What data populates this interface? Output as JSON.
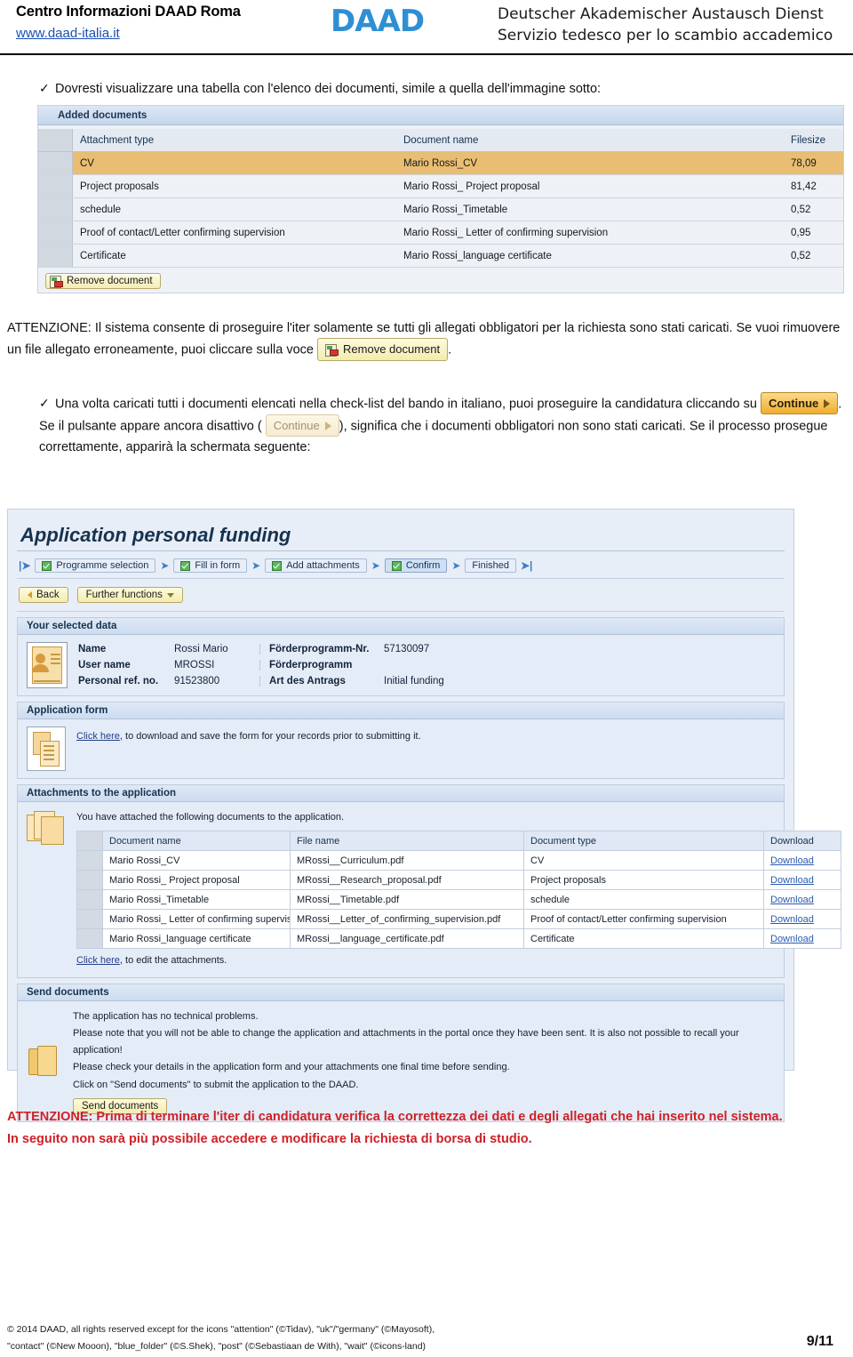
{
  "header": {
    "org_title": "Centro Informazioni DAAD Roma",
    "url": "www.daad-italia.it",
    "logo": "DAAD",
    "line1": "Deutscher Akademischer Austausch Dienst",
    "line2": "Servizio tedesco per lo scambio accademico"
  },
  "intro": {
    "bullet1": "Dovresti visualizzare una tabella con l'elenco dei documenti, simile a quella dell'immagine sotto:"
  },
  "added_documents": {
    "panel_title": "Added documents",
    "columns": [
      "Attachment type",
      "Document name",
      "Filesize"
    ],
    "rows": [
      {
        "type": "CV",
        "name": "Mario Rossi_CV",
        "size": "78,09",
        "selected": true
      },
      {
        "type": "Project proposals",
        "name": "Mario Rossi_ Project proposal",
        "size": "81,42",
        "selected": false
      },
      {
        "type": "schedule",
        "name": "Mario Rossi_Timetable",
        "size": "0,52",
        "selected": false
      },
      {
        "type": "Proof of contact/Letter confirming supervision",
        "name": "Mario Rossi_ Letter of confirming supervision",
        "size": "0,95",
        "selected": false
      },
      {
        "type": "Certificate",
        "name": "Mario Rossi_language certificate",
        "size": "0,52",
        "selected": false
      }
    ],
    "remove_button": "Remove document"
  },
  "warning_para": {
    "part1": "ATTENZIONE: Il sistema consente di proseguire l'iter solamente se tutti gli allegati obbligatori per la richiesta sono stati caricati.  Se vuoi rimuovere un file allegato erroneamente, puoi cliccare sulla voce",
    "remove_button": "Remove document",
    "part2": "."
  },
  "bullet2": {
    "part1": "Una volta caricati tutti i documenti elencati nella check-list del bando in italiano, puoi proseguire la candidatura cliccando su",
    "continue_active": "Continue",
    "part2": ". Se il pulsante appare ancora disattivo (",
    "continue_disabled": "Continue",
    "part3": "), significa che i documenti obbligatori non sono stati caricati.  Se il processo prosegue correttamente, apparirà la schermata seguente:"
  },
  "app_screen": {
    "title": "Application personal funding",
    "steps": [
      {
        "label": "Programme selection",
        "checked": true,
        "current": false
      },
      {
        "label": "Fill in form",
        "checked": true,
        "current": false
      },
      {
        "label": "Add attachments",
        "checked": true,
        "current": false
      },
      {
        "label": "Confirm",
        "checked": true,
        "current": true
      },
      {
        "label": "Finished",
        "checked": false,
        "current": false
      }
    ],
    "toolbar": {
      "back": "Back",
      "further_functions": "Further functions"
    },
    "selected_data": {
      "panel_title": "Your selected data",
      "fields": [
        {
          "key": "Name",
          "value": "Rossi Mario",
          "key2": "Förderprogramm-Nr.",
          "value2": "57130097"
        },
        {
          "key": "User name",
          "value": "MROSSI",
          "key2": "Förderprogramm",
          "value2": ""
        },
        {
          "key": "Personal ref. no.",
          "value": "91523800",
          "key2": "Art des Antrags",
          "value2": "Initial funding"
        }
      ]
    },
    "application_form": {
      "panel_title": "Application form",
      "link": "Click here",
      "text": ", to download and save the form for your records prior to submitting it."
    },
    "attachments": {
      "panel_title": "Attachments to the application",
      "intro": "You have attached the following documents to the application.",
      "columns": [
        "Document name",
        "File name",
        "Document type",
        "Download"
      ],
      "rows": [
        {
          "doc": "Mario Rossi_CV",
          "file": "MRossi__Curriculum.pdf",
          "type": "CV",
          "action": "Download"
        },
        {
          "doc": "Mario Rossi_ Project proposal",
          "file": "MRossi__Research_proposal.pdf",
          "type": "Project proposals",
          "action": "Download"
        },
        {
          "doc": "Mario Rossi_Timetable",
          "file": "MRossi__Timetable.pdf",
          "type": "schedule",
          "action": "Download"
        },
        {
          "doc": "Mario Rossi_ Letter of confirming supervision",
          "file": "MRossi__Letter_of_confirming_supervision.pdf",
          "type": "Proof of contact/Letter confirming supervision",
          "action": "Download"
        },
        {
          "doc": "Mario Rossi_language certificate",
          "file": "MRossi__language_certificate.pdf",
          "type": "Certificate",
          "action": "Download"
        }
      ],
      "edit_link": "Click here",
      "edit_text": ", to edit the attachments."
    },
    "send_documents": {
      "panel_title": "Send documents",
      "lines": [
        "The application has no technical problems.",
        "Please note that you will not be able to change the application and attachments in the portal once they have been sent. It is also not possible to recall your application!",
        "Please check your details in the application form and your attachments one final time before sending.",
        "Click on \"Send documents\" to submit the application to the DAAD."
      ],
      "button": "Send documents"
    }
  },
  "bottom_warning": {
    "line1": "ATTENZIONE: Prima di terminare l'iter di candidatura verifica la correttezza dei dati e degli allegati che hai inserito nel sistema.",
    "line2": "In seguito non sarà più possibile accedere e modificare la richiesta di borsa di studio."
  },
  "footer": {
    "line1": "© 2014 DAAD, all rights reserved  except for the icons \"attention\" (©Tidav), \"uk\"/\"germany\" (©Mayosoft),",
    "line2": "\"contact\" (©New Mooon), \"blue_folder\" (©S.Shek), \"post\" (©Sebastiaan de With), \"wait\" (©icons-land)",
    "page": "9/11"
  },
  "colors": {
    "accent_blue": "#2e8fd4",
    "link_blue": "#1a4fb4",
    "warning_red": "#cf2027",
    "row_highlight": "#e9bd72"
  }
}
